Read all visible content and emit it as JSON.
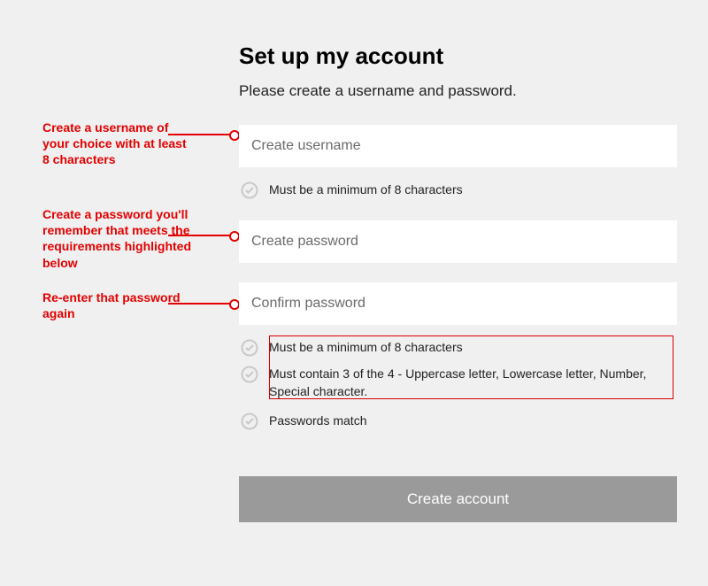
{
  "header": {
    "title": "Set up my account",
    "subtitle": "Please create a username and password."
  },
  "fields": {
    "username_placeholder": "Create username",
    "password_placeholder": "Create password",
    "confirm_placeholder": "Confirm password"
  },
  "requirements": {
    "username": "Must be a minimum of 8 characters",
    "pw_min": "Must be a minimum of 8 characters",
    "pw_complexity": "Must contain 3 of the 4 - Uppercase letter, Lowercase letter, Number, Special character.",
    "pw_match": "Passwords match"
  },
  "button": {
    "create_label": "Create account"
  },
  "callouts": {
    "username": "Create a username of your choice with at least 8 characters",
    "password": "Create a password you'll remember that meets the requirements highlighted below",
    "confirm": "Re-enter that password again"
  },
  "colors": {
    "accent_red": "#e40000",
    "button_bg": "#9a9a9a"
  }
}
